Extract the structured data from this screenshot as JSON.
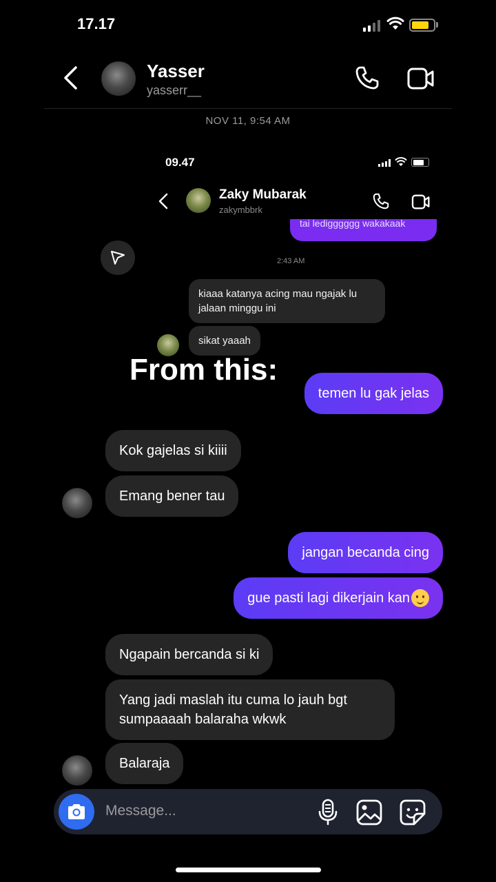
{
  "status_bar": {
    "time": "17.17"
  },
  "header": {
    "name": "Yasser",
    "username": "yasserr__",
    "icons": [
      "back-icon",
      "phone-icon",
      "video-icon"
    ]
  },
  "timestamp": "NOV 11, 9:54 AM",
  "embedded_screenshot": {
    "time": "09.47",
    "name": "Zaky Mubarak",
    "username": "zakymbbrk",
    "partial_outgoing": "tai ledigggggg wakakaak",
    "timestamp": "2:43 AM",
    "incoming": [
      "kiaaa katanya acing mau ngajak lu jalaan minggu ini",
      "sikat yaaah"
    ]
  },
  "overlay_text": "From this:",
  "messages": {
    "out_1": "temen lu gak jelas",
    "in_1": "Kok gajelas si kiiii",
    "in_2": "Emang bener tau",
    "out_2": "jangan becanda cing",
    "out_3": "gue pasti lagi dikerjain kan",
    "in_3": "Ngapain bercanda si ki",
    "in_4": "Yang jadi maslah itu cuma lo jauh bgt sumpaaaah balaraha wkwk",
    "in_5": "Balaraja"
  },
  "composer": {
    "placeholder": "Message..."
  },
  "colors": {
    "outgoing_bubble": "#6a36f2",
    "incoming_bubble": "#262626",
    "camera_button": "#2f6cf0",
    "background": "#000000"
  }
}
